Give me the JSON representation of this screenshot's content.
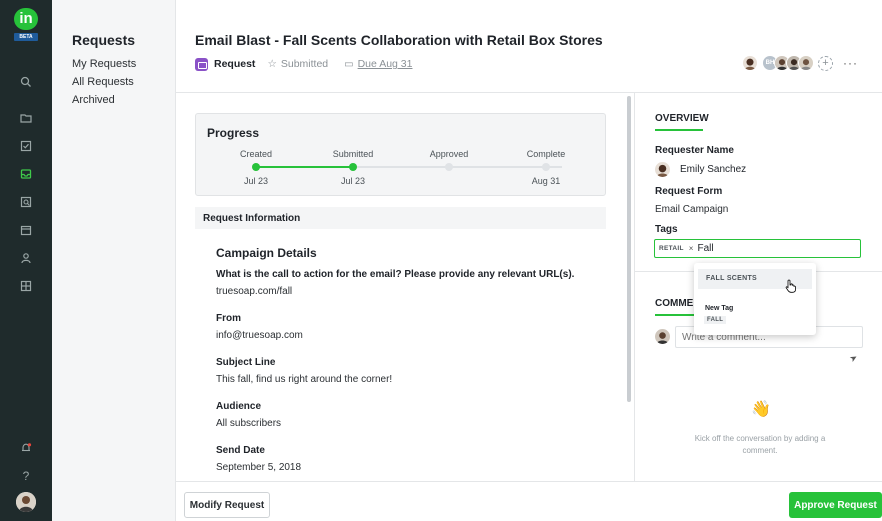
{
  "app": {
    "logo_text": "in",
    "logo_badge": "BETA",
    "rail_icons": [
      "search-icon",
      "folder-icon",
      "checkbox-icon",
      "inbox-icon",
      "review-icon",
      "calendar-icon",
      "user-icon",
      "grid-icon",
      "bell-icon",
      "help-icon"
    ],
    "help_label": "?",
    "accent_color": "#27c23a"
  },
  "nav": {
    "title": "Requests",
    "items": [
      {
        "label": "My Requests"
      },
      {
        "label": "All Requests"
      },
      {
        "label": "Archived"
      }
    ]
  },
  "header": {
    "title": "Email Blast - Fall Scents Collaboration with Retail Box Stores",
    "type_label": "Request",
    "status_label": "Submitted",
    "due_label": "Due Aug 31",
    "collaborator_initials": "BH",
    "more_label": "···"
  },
  "progress": {
    "title": "Progress",
    "steps": [
      {
        "label": "Created",
        "date": "Jul 23",
        "done": true
      },
      {
        "label": "Submitted",
        "date": "Jul 23",
        "done": true
      },
      {
        "label": "Approved",
        "date": "",
        "done": false
      },
      {
        "label": "Complete",
        "date": "Aug 31",
        "done": false
      }
    ]
  },
  "request_info": {
    "section_label": "Request Information",
    "details_title": "Campaign Details",
    "fields": [
      {
        "question": "What is the call to action for the email? Please provide any relevant URL(s).",
        "answer": "truesoap.com/fall"
      },
      {
        "question": "From",
        "answer": "info@truesoap.com"
      },
      {
        "question": "Subject Line",
        "answer": "This fall, find us right around the corner!"
      },
      {
        "question": "Audience",
        "answer": "All subscribers"
      },
      {
        "question": "Send Date",
        "answer": "September 5, 2018"
      }
    ]
  },
  "overview": {
    "tab_label": "OVERVIEW",
    "requester_label": "Requester Name",
    "requester_name": "Emily Sanchez",
    "form_label": "Request Form",
    "form_value": "Email Campaign",
    "tags_label": "Tags",
    "tag_chip": "RETAIL",
    "tag_remove": "×",
    "tag_input_value": "Fall"
  },
  "tag_dropdown": {
    "option": "FALL SCENTS",
    "new_tag_label": "New Tag",
    "new_tag_value": "FALL"
  },
  "comments": {
    "tab_label": "COMMENTS",
    "placeholder": "Write a comment...",
    "empty_emoji": "👋",
    "empty_text": "Kick off the conversation by adding a comment."
  },
  "footer": {
    "modify_label": "Modify Request",
    "approve_label": "Approve Request"
  }
}
